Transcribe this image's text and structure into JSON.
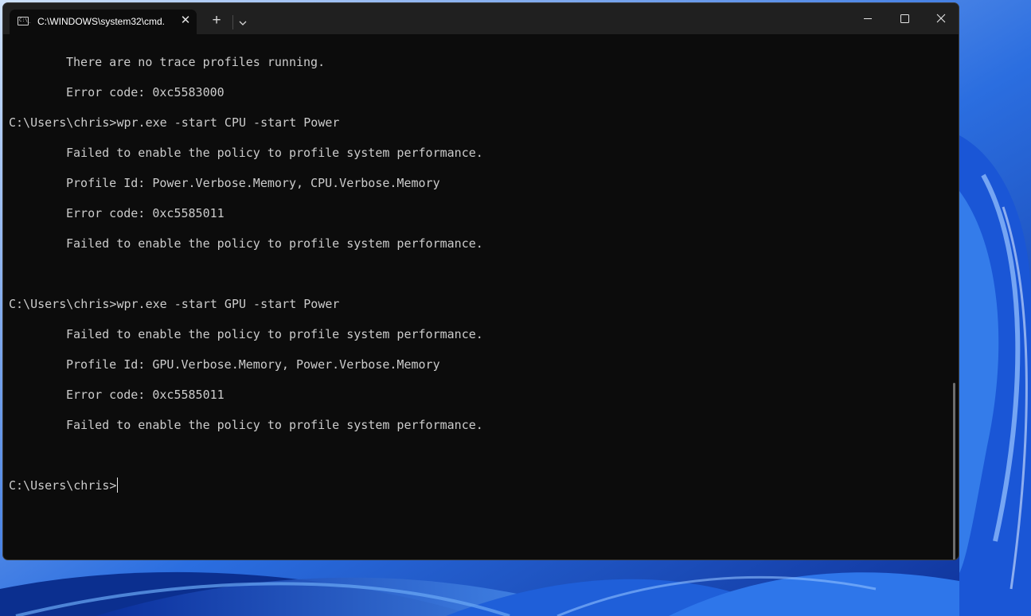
{
  "window": {
    "tab_title": "C:\\WINDOWS\\system32\\cmd.",
    "tab_icon": "C:\\_",
    "close_glyph": "✕",
    "new_tab_glyph": "+",
    "controls": [
      "minimize-icon",
      "maximize-icon",
      "close-icon"
    ]
  },
  "terminal": {
    "lines": [
      "There are no trace profiles running.",
      "Error code: 0xc5583000",
      "C:\\Users\\chris>wpr.exe -start CPU -start Power",
      "Failed to enable the policy to profile system performance.",
      "Profile Id: Power.Verbose.Memory, CPU.Verbose.Memory",
      "Error code: 0xc5585011",
      "Failed to enable the policy to profile system performance.",
      "C:\\Users\\chris>wpr.exe -start GPU -start Power",
      "Failed to enable the policy to profile system performance.",
      "Profile Id: GPU.Verbose.Memory, Power.Verbose.Memory",
      "Error code: 0xc5585011",
      "Failed to enable the policy to profile system performance.",
      "C:\\Users\\chris>"
    ]
  },
  "colors": {
    "terminal_bg": "#0c0c0c",
    "titlebar_bg": "#202020",
    "text": "#cccccc",
    "wallpaper_accent": "#1b4fb8"
  }
}
